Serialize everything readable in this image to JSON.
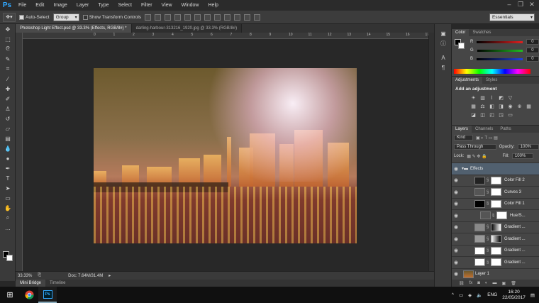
{
  "app": {
    "logo": "Ps",
    "menus": [
      "File",
      "Edit",
      "Image",
      "Layer",
      "Type",
      "Select",
      "Filter",
      "View",
      "Window",
      "Help"
    ]
  },
  "options": {
    "auto_select": "Auto-Select",
    "group_value": "Group",
    "show_transform": "Show Transform Controls",
    "workspace": "Essentials"
  },
  "tabs": [
    {
      "label": "Photoshop Light Effect.psd @ 33.3% (Effects, RGB/8#) *",
      "active": true
    },
    {
      "label": "darling-harbour-313216_1920.jpg @ 33.3% (RGB/8#)",
      "active": false
    }
  ],
  "ruler": {
    "h_ticks": [
      "0",
      "1",
      "2",
      "3",
      "4",
      "5",
      "6",
      "7",
      "8",
      "9",
      "10",
      "11",
      "12",
      "13",
      "14",
      "15",
      "16",
      "17",
      "18",
      "19",
      "20",
      "21"
    ]
  },
  "status": {
    "zoom": "33.33%",
    "doc": "Doc: 7.64M/31.4M"
  },
  "bottom_tabs": [
    "Mini Bridge",
    "Timeline"
  ],
  "color_panel": {
    "tabs": [
      "Color",
      "Swatches"
    ],
    "channels": [
      {
        "label": "R",
        "value": "0",
        "color": "#e02020"
      },
      {
        "label": "G",
        "value": "0",
        "color": "#20c020"
      },
      {
        "label": "B",
        "value": "0",
        "color": "#2040e0"
      }
    ]
  },
  "adjustments": {
    "tabs": [
      "Adjustments",
      "Styles"
    ],
    "title": "Add an adjustment"
  },
  "layers": {
    "tabs": [
      "Layers",
      "Channels",
      "Paths"
    ],
    "kind": "Kind",
    "blend": "Pass Through",
    "opacity_label": "Opacity:",
    "opacity": "100%",
    "lock_label": "Lock:",
    "fill_label": "Fill:",
    "fill": "100%",
    "items": [
      {
        "name": "Effects",
        "type": "group"
      },
      {
        "name": "Color Fill 2",
        "thumb": "#222"
      },
      {
        "name": "Curves 3",
        "thumb": "#555"
      },
      {
        "name": "Color Fill 1",
        "thumb": "#000"
      },
      {
        "name": "Hue/S...",
        "thumb": "#555"
      },
      {
        "name": "Gradient ...",
        "thumb": "#888"
      },
      {
        "name": "Gradient ...",
        "thumb": "#999"
      },
      {
        "name": "Gradient ...",
        "thumb": "#fff"
      },
      {
        "name": "Gradient ...",
        "thumb": "#fff"
      },
      {
        "name": "Layer 1",
        "thumb": "#7a5a30"
      }
    ]
  },
  "taskbar": {
    "lang": "ENG",
    "time": "16:20",
    "date": "22/05/2017"
  }
}
